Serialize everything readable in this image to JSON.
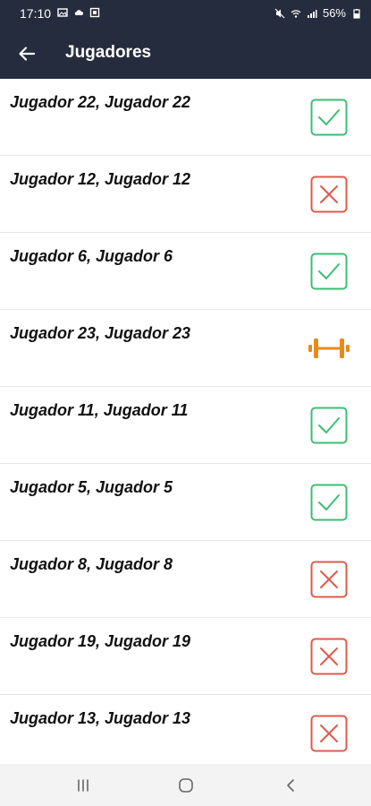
{
  "status_bar": {
    "time": "17:10",
    "battery": "56%"
  },
  "app_bar": {
    "title": "Jugadores"
  },
  "players": [
    {
      "name": "Jugador 22, Jugador 22",
      "status": "check"
    },
    {
      "name": "Jugador 12, Jugador 12",
      "status": "cross"
    },
    {
      "name": "Jugador 6, Jugador 6",
      "status": "check"
    },
    {
      "name": "Jugador 23, Jugador 23",
      "status": "dumbbell"
    },
    {
      "name": "Jugador 11, Jugador 11",
      "status": "check"
    },
    {
      "name": "Jugador 5, Jugador 5",
      "status": "check"
    },
    {
      "name": "Jugador 8, Jugador 8",
      "status": "cross"
    },
    {
      "name": "Jugador 19, Jugador 19",
      "status": "cross"
    },
    {
      "name": "Jugador 13, Jugador 13",
      "status": "cross"
    }
  ],
  "colors": {
    "header": "#252c3d",
    "check": "#3bbf73",
    "cross": "#e05a4b",
    "dumbbell": "#e98a1d"
  },
  "icons": {
    "check": "check-square-icon",
    "cross": "x-square-icon",
    "dumbbell": "dumbbell-icon"
  }
}
